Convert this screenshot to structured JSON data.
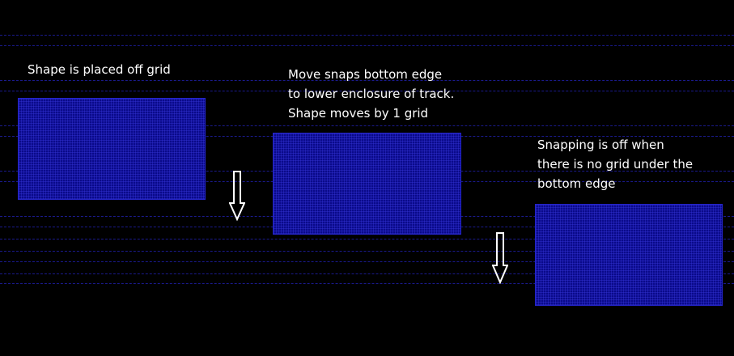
{
  "colors": {
    "background": "#000000",
    "grid_track": "#1a1a8c",
    "shape_fill": "#0a0a8a",
    "shape_border": "#2424c8",
    "text": "#ffffff",
    "arrow": "#ffffff"
  },
  "captions": {
    "step1": [
      "Shape is placed off grid"
    ],
    "step2": [
      "Move snaps bottom edge",
      "to lower enclosure of track.",
      "Shape moves by 1 grid"
    ],
    "step3": [
      "Snapping is off when",
      "there is no grid under the",
      "bottom edge"
    ]
  },
  "icons": {
    "arrow1": "arrow-down-icon",
    "arrow2": "arrow-down-icon"
  }
}
